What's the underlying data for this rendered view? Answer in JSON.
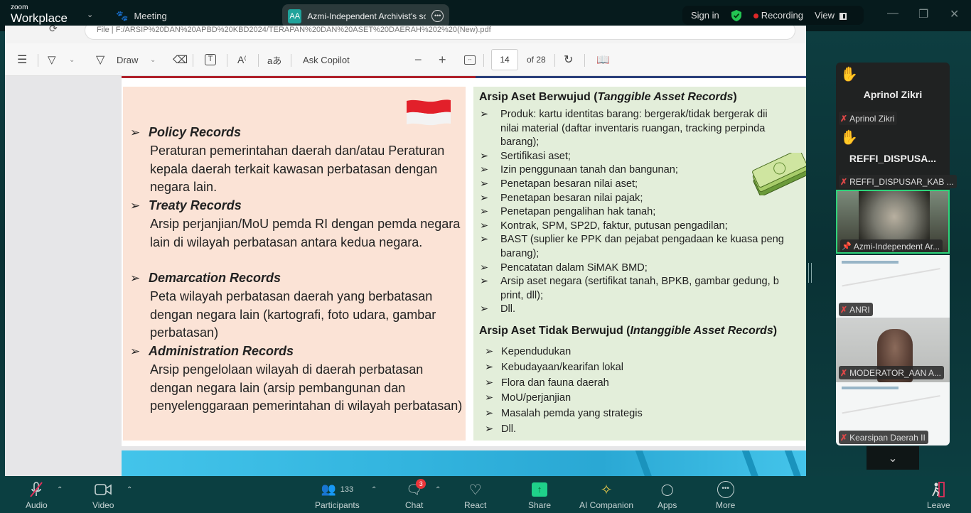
{
  "titlebar": {
    "brand_small": "zoom",
    "brand_big": "Workplace",
    "meeting_label": "Meeting",
    "share_initials": "AA",
    "share_title": "Azmi-Independent Archivist's screen",
    "sign_in": "Sign in",
    "recording": "Recording",
    "view": "View"
  },
  "pdf": {
    "address": "File  |  F:/ARSIP%20DAN%20APBD%20KBD2024/TERAPAN%20DAN%20ASET%20DAERAH%202%20(New).pdf",
    "toolbar": {
      "draw": "Draw",
      "ask_copilot": "Ask Copilot",
      "page_current": "14",
      "page_total": "of 28"
    }
  },
  "slide": {
    "left_sections": [
      {
        "heading": "Policy Records",
        "body": "Peraturan pemerintahan daerah dan/atau Peraturan kepala daerah terkait kawasan perbatasan dengan negara lain."
      },
      {
        "heading": "Treaty Records",
        "body": "Arsip perjanjian/MoU pemda RI dengan pemda negara lain di wilayah perbatasan antara kedua negara."
      },
      {
        "heading": "Demarcation Records",
        "body": "Peta wilayah perbatasan daerah yang berbatasan dengan negara lain (kartografi, foto udara, gambar perbatasan)"
      },
      {
        "heading": "Administration Records",
        "body": "Arsip pengelolaan wilayah di daerah perbatasan dengan negara lain (arsip pembangunan dan penyelenggaraan pemerintahan di wilayah perbatasan)"
      }
    ],
    "tangible_title_main": "Arsip Aset Berwujud (",
    "tangible_title_italic": "Tanggible Asset Records",
    "tangible_title_end": ")",
    "tangible_items": [
      "Produk: kartu identitas barang: bergerak/tidak bergerak dii",
      "nilai material (daftar inventaris ruangan, tracking perpinda",
      "barang);",
      "Sertifikasi aset;",
      "Izin penggunaan tanah dan bangunan;",
      "Penetapan besaran nilai aset;",
      "Penetapan besaran nilai pajak;",
      "Penetapan pengalihan hak tanah;",
      "Kontrak, SPM, SP2D, faktur, putusan pengadilan;",
      "BAST (suplier ke PPK dan pejabat pengadaan ke kuasa peng",
      "barang);",
      "Pencatatan dalam SiMAK BMD;",
      "Arsip aset negara (sertifikat tanah, BPKB, gambar gedung, b",
      "print, dll);",
      "Dll."
    ],
    "intangible_title_main": "Arsip Aset Tidak Berwujud (",
    "intangible_title_italic": "Intanggible Asset Records",
    "intangible_title_end": ")",
    "intangible_items": [
      "Kependudukan",
      "Kebudayaan/kearifan lokal",
      "Flora dan fauna daerah",
      "MoU/perjanjian",
      "Masalah pemda yang strategis",
      "Dll."
    ]
  },
  "participants_panel": {
    "tiles": [
      {
        "display": "Aprinol Zikri",
        "name": "Aprinol Zikri",
        "hand_raised": true,
        "muted": true
      },
      {
        "display": "REFFI_DISPUSA...",
        "name": "REFFI_DISPUSAR_KAB ...",
        "hand_raised": true,
        "muted": true
      },
      {
        "name": "Azmi-Independent Ar...",
        "active_speaker": true,
        "video": true
      },
      {
        "name": "ANRI",
        "muted": true
      },
      {
        "name": "MODERATOR_AAN A...",
        "muted": true,
        "video": true
      },
      {
        "name": "Kearsipan Daerah II",
        "muted": true
      }
    ]
  },
  "bottombar": {
    "audio": "Audio",
    "video": "Video",
    "participants": "Participants",
    "participants_count": "133",
    "chat": "Chat",
    "chat_badge": "3",
    "react": "React",
    "share": "Share",
    "ai_companion": "AI Companion",
    "apps": "Apps",
    "more": "More",
    "leave": "Leave"
  }
}
